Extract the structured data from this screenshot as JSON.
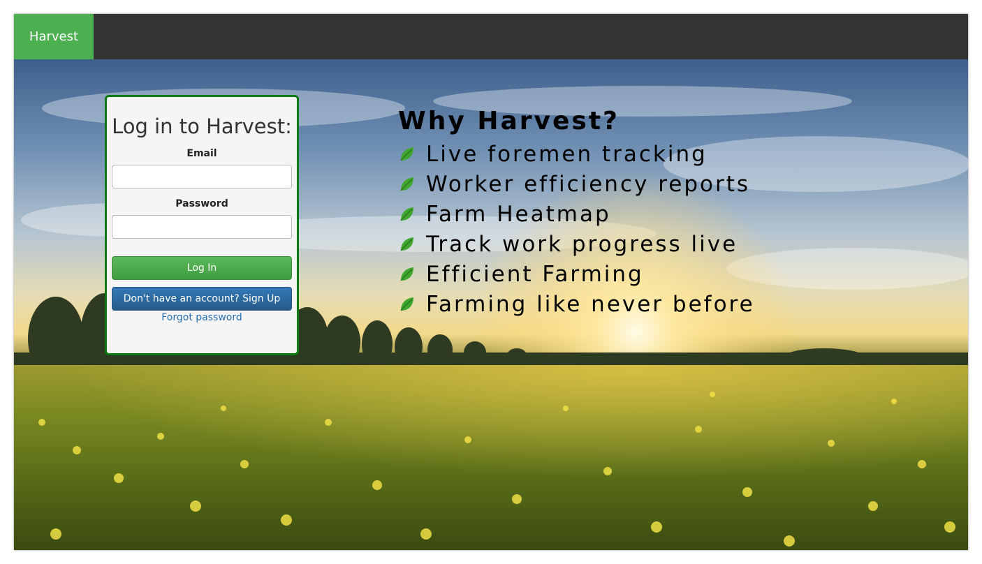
{
  "navbar": {
    "brand": "Harvest",
    "background": "#333333",
    "brand_color": "#4caf50"
  },
  "login": {
    "title": "Log in to Harvest:",
    "email_label": "Email",
    "email_value": "",
    "password_label": "Password",
    "password_value": "",
    "login_button": "Log In",
    "signup_button": "Don't have an account? Sign Up",
    "forgot_link": "Forgot password",
    "border_color": "#0b7a12"
  },
  "why": {
    "title": "Why Harvest?",
    "icon": "leaf-icon",
    "features": [
      "Live foremen tracking",
      "Worker efficiency reports",
      "Farm Heatmap",
      "Track work progress live",
      "Efficient Farming",
      "Farming like never before"
    ]
  },
  "hero": {
    "image": "rapeseed field at sunset"
  }
}
